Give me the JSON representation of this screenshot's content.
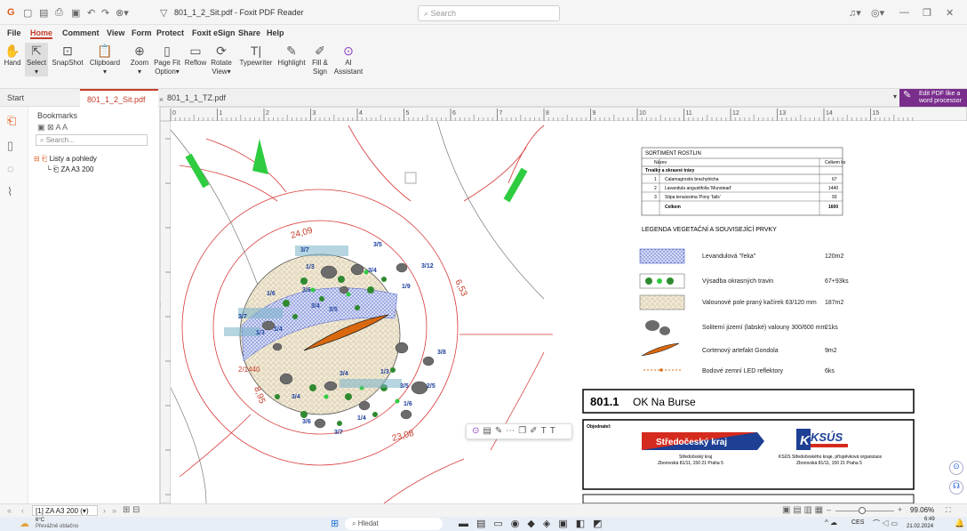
{
  "window": {
    "title": "801_1_2_Sit.pdf - Foxit PDF Reader",
    "search_placeholder": "Search"
  },
  "menu": [
    "File",
    "Home",
    "Comment",
    "View",
    "Form",
    "Protect",
    "Foxit eSign",
    "Share",
    "Help"
  ],
  "ribbon": {
    "hand": "Hand",
    "select": "Select",
    "snapshot": "SnapShot",
    "clipboard": "Clipboard",
    "zoom": "Zoom",
    "pagefit": "Page Fit",
    "pagefit2": "Option",
    "reflow": "Reflow",
    "rotate": "Rotate",
    "rotate2": "View",
    "typewriter": "Typewriter",
    "highlight": "Highlight",
    "fill": "Fill &",
    "fill2": "Sign",
    "ai": "AI",
    "ai2": "Assistant"
  },
  "tabs": {
    "start": "Start",
    "tab1": "801_1_2_Sit.pdf",
    "tab2": "801_1_1_TZ.pdf",
    "edit_promo_1": "Edit PDF like a",
    "edit_promo_2": "word processor"
  },
  "bookmarks": {
    "header": "Bookmarks",
    "search_placeholder": "Search...",
    "items": [
      "Listy a pohledy",
      "ZA A3 200"
    ]
  },
  "ruler_numbers": [
    "0",
    "1",
    "2",
    "3",
    "4",
    "5",
    "6",
    "7",
    "8",
    "9",
    "10",
    "11",
    "12",
    "13",
    "14",
    "15"
  ],
  "plant_table": {
    "title": "SORTIMENT ROSTLIN",
    "col_name": "Název",
    "col_total": "Celkem ks",
    "group": "Trvalky a okrasné trávy",
    "rows": [
      {
        "n": "1",
        "name": "Calamagrostis brachytricha",
        "qty": "67"
      },
      {
        "n": "2",
        "name": "Lavandula angustifolia 'Munstead'",
        "qty": "1440"
      },
      {
        "n": "3",
        "name": "Stipa tenuissima 'Pony Tails'",
        "qty": "93"
      }
    ],
    "sum_label": "Celkem",
    "sum_value": "1600"
  },
  "legend": {
    "title": "LEGENDA VEGETAČNÍ A SOUVISEJÍCÍ PRVKY",
    "items": [
      {
        "label": "Levandulová \"řeka\"",
        "value": "120m2"
      },
      {
        "label": "Výsadba okrasných travin",
        "value": "67+93ks"
      },
      {
        "label": "Valounové pole praný kačírek 63/120 mm",
        "value": "187m2"
      },
      {
        "label": "Solitemí jizemí (labské) valouny 300/600 mm",
        "value": "21ks"
      },
      {
        "label": "Cortenový artefakt Gondola",
        "value": "9m2"
      },
      {
        "label": "Bodové zemní LED reflektory",
        "value": "6ks"
      }
    ]
  },
  "drawing_title": {
    "code": "801.1",
    "name": "OK Na Burse"
  },
  "client": {
    "label": "Objednatel:",
    "sk_name": "Středočeský kraj",
    "sk_addr1": "Středočeský kraj",
    "sk_addr2": "Zborovská 81/11, 150 21 Praha 5",
    "ksus_logo": "KSÚS",
    "ksus_addr1": "KSÚS Středočeského kraje, příspěvková organizace",
    "ksus_addr2": "Zborovská 81/11, 150 21 Praha 5"
  },
  "dims": {
    "d1": "24,09",
    "d2": "6,53",
    "d3": "8,95",
    "d4": "23,08",
    "d5": "2/1440"
  },
  "plant_labels": [
    "3/5",
    "3/7",
    "3/12",
    "1/3",
    "3/4",
    "1/6",
    "3/6",
    "1/9",
    "3/4",
    "3/5",
    "3/7",
    "1/3",
    "1/4",
    "3/8",
    "1/3",
    "3/4",
    "3/5",
    "2/5",
    "3/4",
    "1/6",
    "3/6",
    "3/7",
    "1/4"
  ],
  "status": {
    "page": "[1] ZA A3 200 (",
    "zoom": "99.06%"
  },
  "taskbar": {
    "temp": "6°C",
    "weather": "Převážně oblačno",
    "search": "Hledat",
    "lang": "CES",
    "time": "6:49",
    "date": "21.02.2024"
  }
}
